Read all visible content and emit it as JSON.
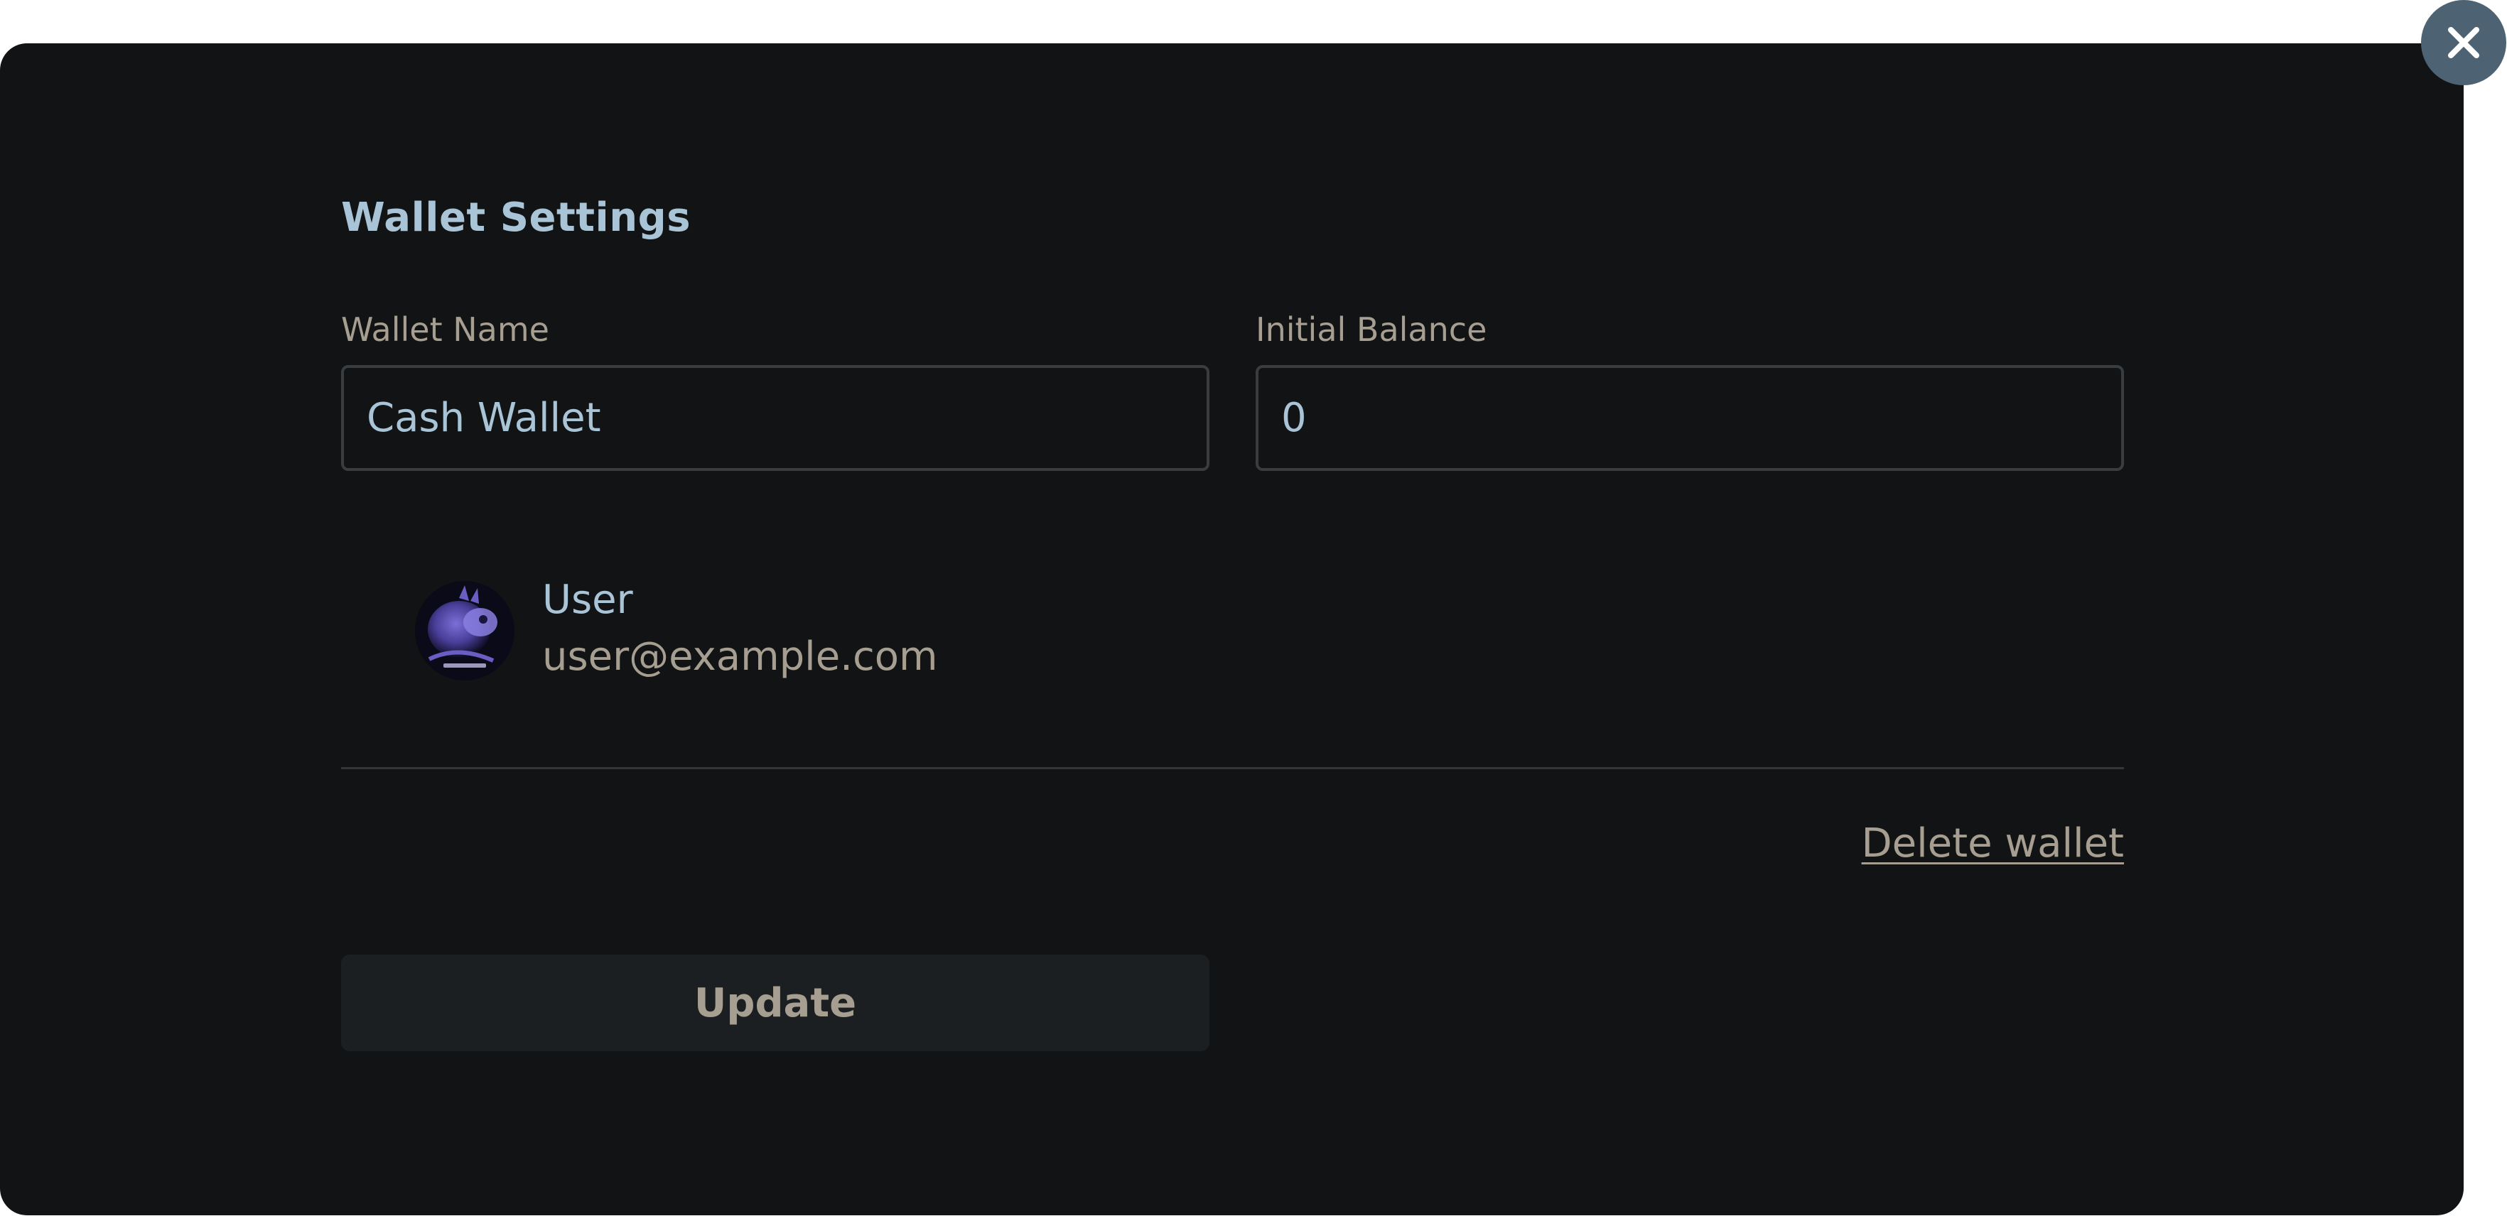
{
  "modal": {
    "title": "Wallet Settings",
    "close_icon": "close-icon"
  },
  "form": {
    "wallet_name": {
      "label": "Wallet Name",
      "value": "Cash Wallet"
    },
    "initial_balance": {
      "label": "Initial Balance",
      "value": "0"
    }
  },
  "owner": {
    "avatar_icon": "avatar-image",
    "name": "User",
    "email": "user@example.com"
  },
  "actions": {
    "delete_label": "Delete wallet",
    "update_label": "Update"
  },
  "colors": {
    "modal_background": "#111315",
    "title": "#a9c4d6",
    "muted_text": "#a69e90",
    "close_button": "#4d6373",
    "button_background": "#1c1f22",
    "input_border": "#3a3d40"
  }
}
